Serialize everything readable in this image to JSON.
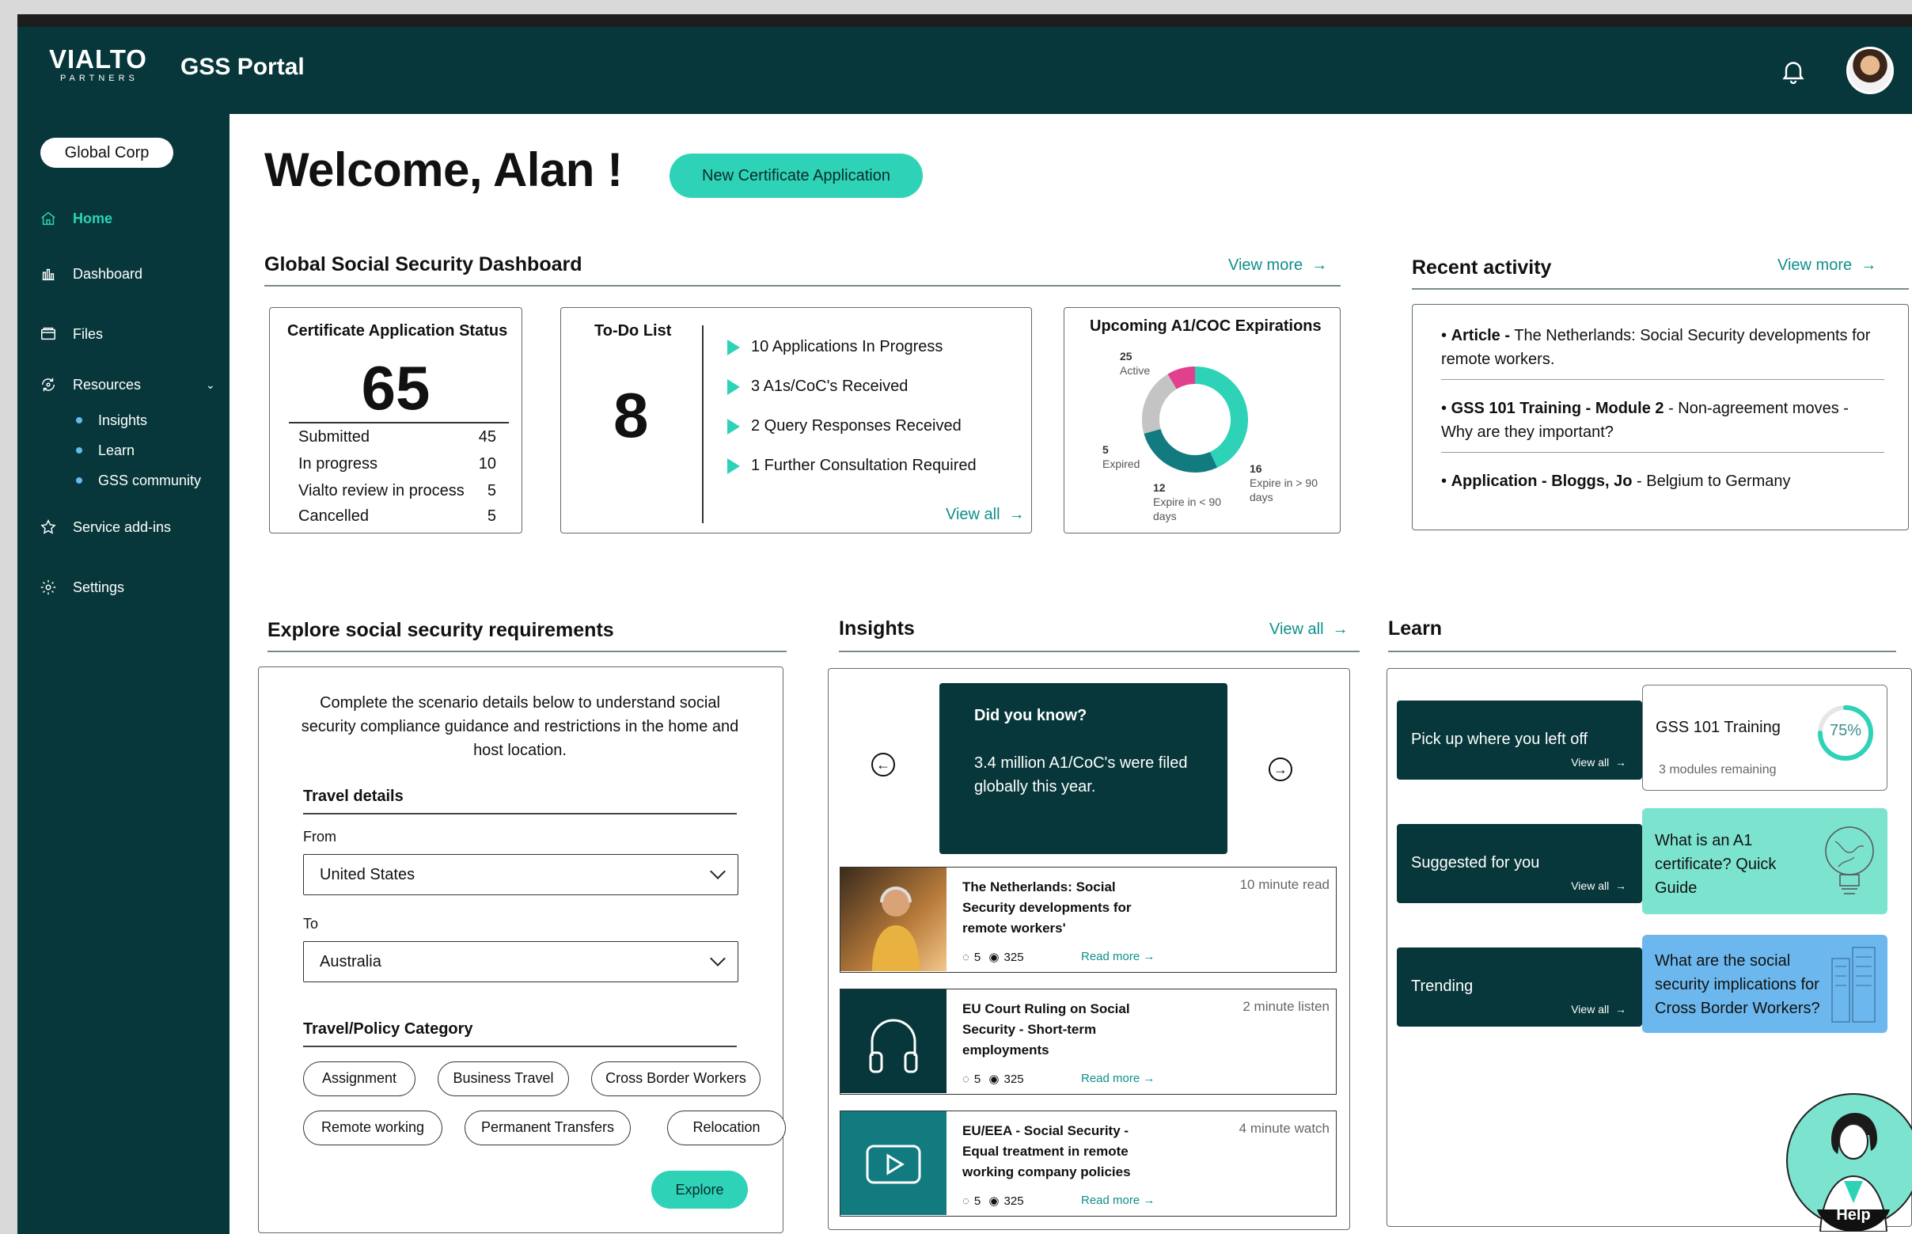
{
  "header": {
    "logo_main": "VIALTO",
    "logo_sub": "PARTNERS",
    "portal_title": "GSS Portal"
  },
  "sidebar": {
    "org": "Global Corp",
    "items": [
      {
        "label": "Home",
        "icon": "home-icon"
      },
      {
        "label": "Dashboard",
        "icon": "bar-chart-icon"
      },
      {
        "label": "Files",
        "icon": "folder-icon"
      },
      {
        "label": "Resources",
        "icon": "resources-icon"
      },
      {
        "label": "Service add-ins",
        "icon": "star-icon"
      },
      {
        "label": "Settings",
        "icon": "gear-icon"
      }
    ],
    "resources_sub": [
      "Insights",
      "Learn",
      "GSS community"
    ]
  },
  "main": {
    "welcome": "Welcome, Alan !",
    "new_application": "New Certificate Application"
  },
  "dashboard": {
    "title": "Global Social Security Dashboard",
    "view_more": "View more",
    "status": {
      "title": "Certificate Application Status",
      "total": "65",
      "rows": [
        {
          "label": "Submitted",
          "value": "45"
        },
        {
          "label": "In progress",
          "value": "10"
        },
        {
          "label": "Vialto review in process",
          "value": "5"
        },
        {
          "label": "Cancelled",
          "value": "5"
        }
      ]
    },
    "todo": {
      "title": "To-Do List",
      "count": "8",
      "items": [
        "10 Applications In Progress",
        "3 A1s/CoC's Received",
        "2 Query Responses Received",
        "1 Further Consultation Required"
      ],
      "view_all": "View all"
    },
    "expirations": {
      "title": "Upcoming A1/COC Expirations",
      "segments": [
        {
          "label": "Active",
          "value": 25,
          "color": "#2ed3b7"
        },
        {
          "label": "Expire in > 90 days",
          "value": 16,
          "color": "#127b80"
        },
        {
          "label": "Expire in < 90 days",
          "value": 12,
          "color": "#c4c4c4"
        },
        {
          "label": "Expired",
          "value": 5,
          "color": "#e0408c"
        }
      ]
    }
  },
  "recent": {
    "title": "Recent activity",
    "view_more": "View more",
    "items": [
      {
        "bold": "Article -",
        "text": " The Netherlands: Social Security developments for remote workers."
      },
      {
        "bold": "GSS 101 Training - Module 2",
        "text": " - Non-agreement moves - Why are they important?"
      },
      {
        "bold": "Application - Bloggs, Jo",
        "text": " - Belgium to Germany"
      }
    ]
  },
  "explore": {
    "title": "Explore social security requirements",
    "intro": "Complete the scenario details below to understand social security compliance guidance and restrictions in the home and host location.",
    "travel_details": "Travel details",
    "from_label": "From",
    "from_value": "United States",
    "to_label": "To",
    "to_value": "Australia",
    "category_title": "Travel/Policy Category",
    "chips": [
      "Assignment",
      "Business Travel",
      "Cross Border Workers",
      "Remote  working",
      "Permanent Transfers",
      "Relocation"
    ],
    "explore_btn": "Explore"
  },
  "insights": {
    "title": "Insights",
    "view_all": "View all",
    "dyk_title": "Did you know?",
    "dyk_text": "3.4 million A1/CoC's were filed globally this year.",
    "articles": [
      {
        "title": "The Netherlands: Social Security developments for remote workers'",
        "meta": "10 minute read",
        "comments": "5",
        "views": "325",
        "read": "Read more"
      },
      {
        "title": "EU Court Ruling on Social Security - Short-term employments",
        "meta": "2 minute listen",
        "comments": "5",
        "views": "325",
        "read": "Read more"
      },
      {
        "title": "EU/EEA - Social Security - Equal treatment in remote working company policies",
        "meta": "4 minute watch",
        "comments": "5",
        "views": "325",
        "read": "Read more"
      }
    ]
  },
  "learn": {
    "title": "Learn",
    "rows": [
      {
        "label": "Pick up where you left off",
        "view_all": "View all",
        "tile": "GSS 101 Training",
        "sub": "3 modules remaining",
        "progress": 75,
        "progress_text": "75%"
      },
      {
        "label": "Suggested for you",
        "view_all": "View all",
        "tile": "What is an A1 certificate? Quick Guide"
      },
      {
        "label": "Trending",
        "view_all": "View all",
        "tile": "What are the social security implications for Cross Border Workers?"
      }
    ]
  },
  "help": {
    "label": "Help"
  }
}
